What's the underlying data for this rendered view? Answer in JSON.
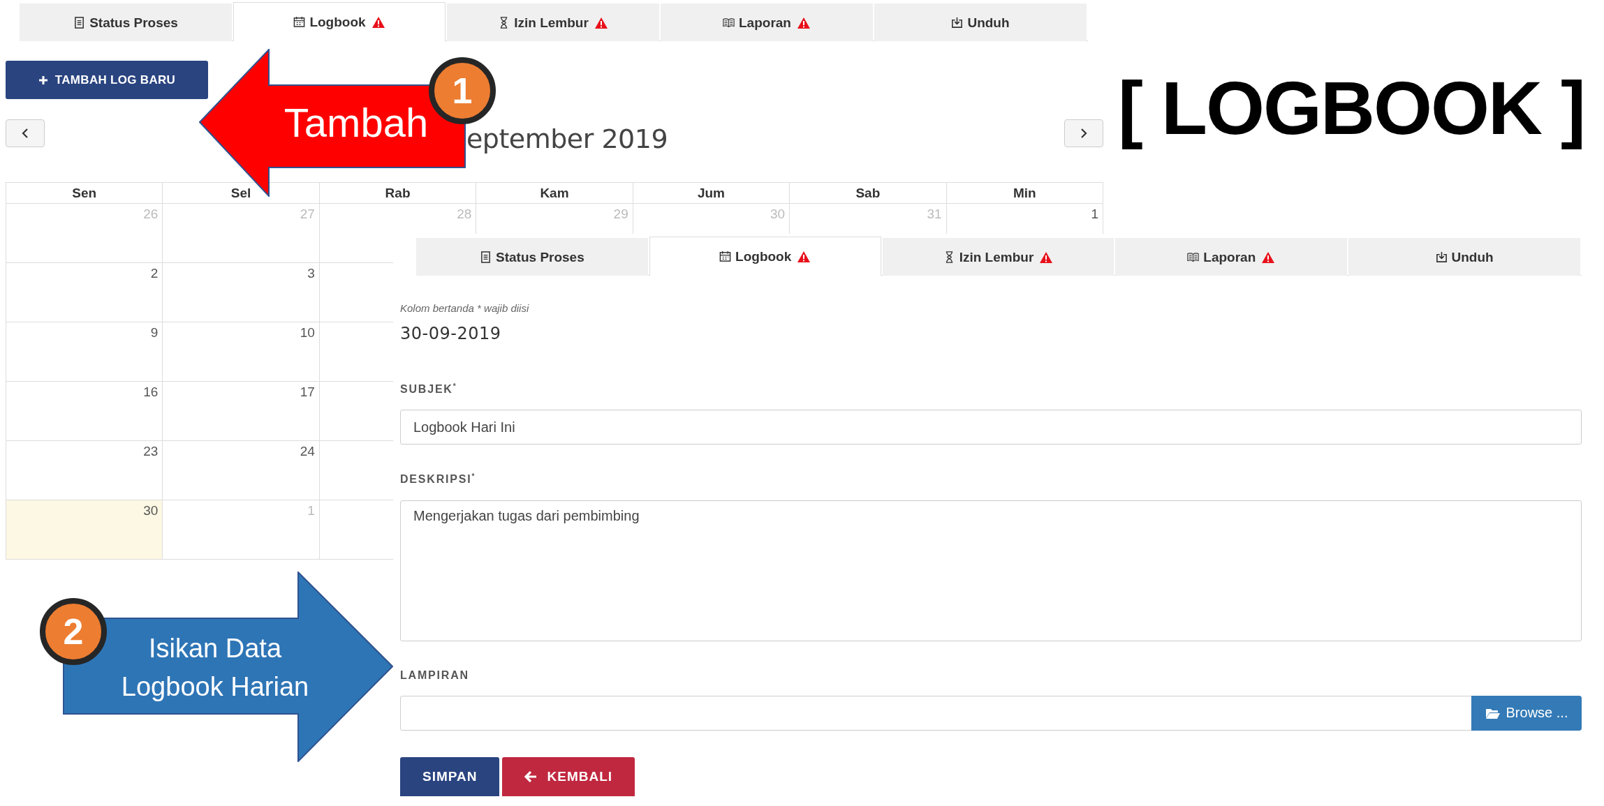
{
  "background_screen": {
    "tabs": [
      {
        "label": "Status Proses",
        "warning": false,
        "selected": false
      },
      {
        "label": "Logbook",
        "warning": true,
        "selected": true
      },
      {
        "label": "Izin Lembur",
        "warning": true,
        "selected": false
      },
      {
        "label": "Laporan",
        "warning": true,
        "selected": false
      },
      {
        "label": "Unduh",
        "warning": false,
        "selected": false
      }
    ],
    "add_button": "TAMBAH LOG BARU",
    "month_title": "eptember 2019",
    "calendar": {
      "weekdays": [
        "Sen",
        "Sel",
        "Rab",
        "Kam",
        "Jum",
        "Sab",
        "Min"
      ],
      "weeks": [
        {
          "days": [
            {
              "day": "26",
              "muted": true,
              "today": false
            },
            {
              "day": "27",
              "muted": true,
              "today": false
            },
            {
              "day": "28",
              "muted": true,
              "today": false
            },
            {
              "day": "29",
              "muted": true,
              "today": false
            },
            {
              "day": "30",
              "muted": true,
              "today": false
            },
            {
              "day": "31",
              "muted": true,
              "today": false
            },
            {
              "day": "1",
              "muted": false,
              "today": false
            }
          ]
        },
        {
          "days": [
            {
              "day": "2",
              "muted": false,
              "today": false
            },
            {
              "day": "3",
              "muted": false,
              "today": false
            }
          ]
        },
        {
          "days": [
            {
              "day": "9",
              "muted": false,
              "today": false
            },
            {
              "day": "10",
              "muted": false,
              "today": false
            }
          ]
        },
        {
          "days": [
            {
              "day": "16",
              "muted": false,
              "today": false
            },
            {
              "day": "17",
              "muted": false,
              "today": false
            }
          ]
        },
        {
          "days": [
            {
              "day": "23",
              "muted": false,
              "today": false
            },
            {
              "day": "24",
              "muted": false,
              "today": false
            }
          ]
        },
        {
          "days": [
            {
              "day": "30",
              "muted": false,
              "today": true
            },
            {
              "day": "1",
              "muted": true,
              "today": false
            }
          ]
        }
      ]
    }
  },
  "form_screen": {
    "tabs": [
      {
        "label": "Status Proses",
        "warning": false,
        "selected": false
      },
      {
        "label": "Logbook",
        "warning": true,
        "selected": true
      },
      {
        "label": "Izin Lembur",
        "warning": true,
        "selected": false
      },
      {
        "label": "Laporan",
        "warning": true,
        "selected": false
      },
      {
        "label": "Unduh",
        "warning": false,
        "selected": false
      }
    ],
    "required_note": "Kolom bertanda * wajib diisi",
    "date": "30-09-2019",
    "fields": [
      {
        "kind": "text",
        "label": "SUBJEK$^{*}$",
        "value": "Logbook Hari Ini"
      },
      {
        "kind": "textarea",
        "label": "DESKRIPSI$^{*}$",
        "value": "Mengerjakan tugas dari pembimbing"
      },
      {
        "kind": "file",
        "label": "LAMPIRAN",
        "browse_label": "Browse ..."
      }
    ],
    "buttons": [
      {
        "kind": "primary",
        "label": "SIMPAN"
      },
      {
        "kind": "danger",
        "label": "KEMBALI"
      }
    ]
  },
  "page_title": "[ LOGBOOK ]",
  "annotations": [
    {
      "kind": "arrow-left",
      "color": "#ff0000",
      "label": "Tambah",
      "step": "1"
    },
    {
      "kind": "arrow-right",
      "color": "#2e75b6",
      "label": "Isikan Data\nLogbook Harian",
      "step": "2"
    }
  ]
}
